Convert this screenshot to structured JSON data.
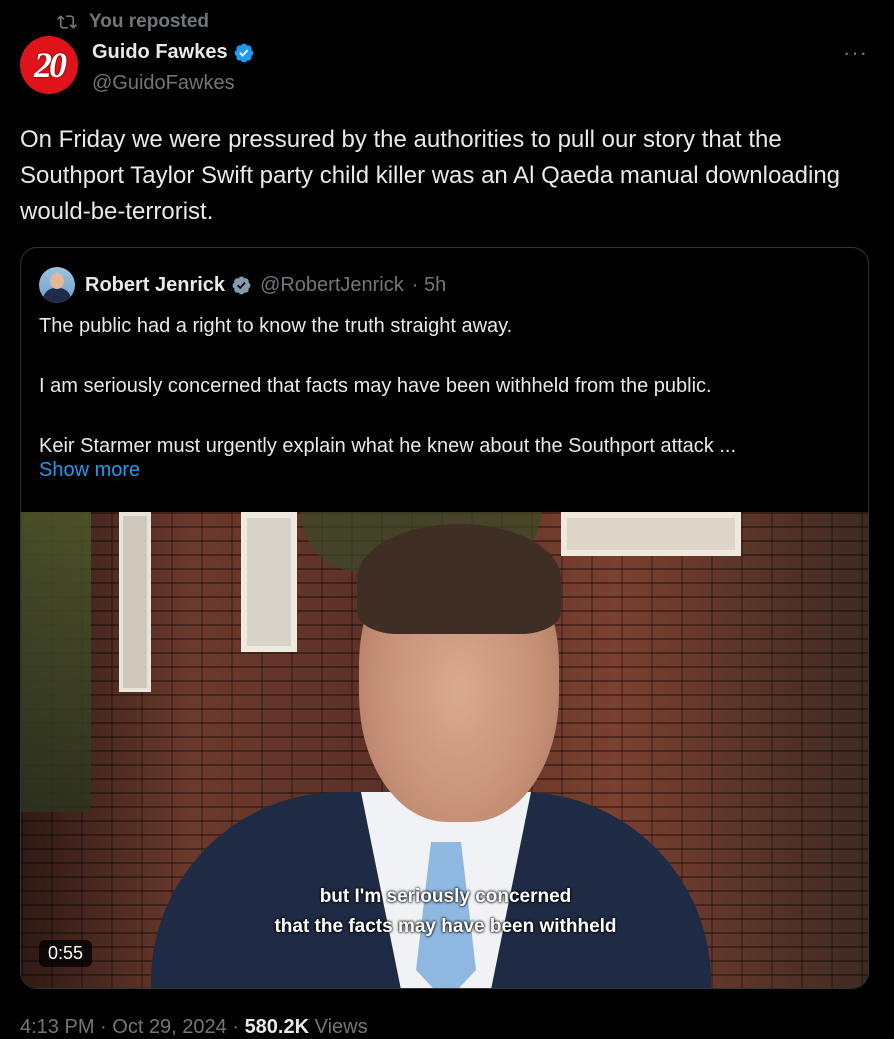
{
  "repost": {
    "label": "You reposted"
  },
  "tweet": {
    "author_name": "Guido Fawkes",
    "author_handle": "@GuidoFawkes",
    "avatar_text": "20",
    "text": "On Friday we were pressured by the authorities to pull our story that the Southport Taylor Swift party child killer was an Al Qaeda manual downloading would-be-terrorist."
  },
  "quote": {
    "author_name": "Robert Jenrick",
    "author_handle": "@RobertJenrick",
    "time": "· 5h",
    "paragraphs": [
      "The public had a right to know the truth straight away.",
      "I am seriously concerned that facts may have been withheld from the public.",
      "Keir Starmer must urgently explain what he knew about the Southport attack ..."
    ],
    "show_more": "Show more",
    "video": {
      "subtitle_line1": "but I'm seriously concerned",
      "subtitle_line2": "that the facts may have been withheld",
      "duration": "0:55"
    }
  },
  "footer": {
    "timestamp": "4:13 PM · Oct 29, 2024 ·",
    "views_count": "580.2K",
    "views_label": "Views"
  },
  "colors": {
    "background": "#000000",
    "accent": "#1d9bf0",
    "muted": "#71767b",
    "avatar_red": "#e0131a"
  }
}
